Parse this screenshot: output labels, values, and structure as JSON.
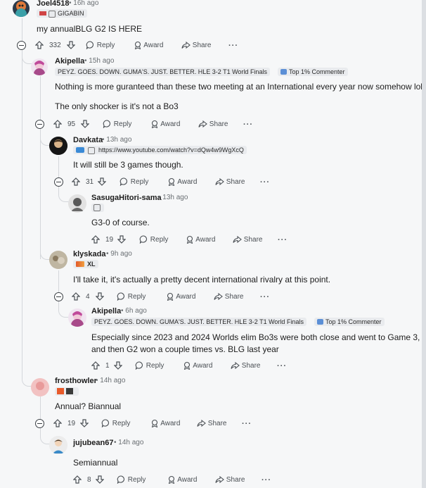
{
  "actions_labels": {
    "reply": "Reply",
    "award": "Award",
    "share": "Share",
    "more": "···"
  },
  "comments": [
    {
      "user": "Joel4518",
      "time": "16h ago",
      "flair": "GIGABIN",
      "text": "my annualBLG G2 IS HERE",
      "votes": "332"
    },
    {
      "user": "Akipella",
      "time": "15h ago",
      "flair": "PEYZ. GOES. DOWN. GUMA'S. JUST. BETTER. HLE 3-2 T1 World Finals",
      "badge": "Top 1% Commenter",
      "text": "Nothing is more guranteed than these two meeting at an International every year now somehow lol",
      "text2": "The only shocker is it's not a Bo3",
      "votes": "95"
    },
    {
      "user": "Davkata",
      "time": "13h ago",
      "flair": "https://www.youtube.com/watch?v=dQw4w9WgXcQ",
      "text": "It will still be 3 games though.",
      "votes": "31"
    },
    {
      "user": "SasugaHitori-sama",
      "time": "13h ago",
      "text": "G3-0 of course.",
      "votes": "19"
    },
    {
      "user": "klyskada",
      "time": "9h ago",
      "flair": "XL",
      "text": "I'll take it, it's actually a pretty decent international rivalry at this point.",
      "votes": "4"
    },
    {
      "user": "Akipella",
      "time": "6h ago",
      "flair": "PEYZ. GOES. DOWN. GUMA'S. JUST. BETTER. HLE 3-2 T1 World Finals",
      "badge": "Top 1% Commenter",
      "text": "Especially since 2023 and 2024 Worlds elim Bo3s were both close and went to Game 3, and then G2 won a couple times vs. BLG last year",
      "votes": "1"
    },
    {
      "user": "frosthowler",
      "time": "14h ago",
      "text": "Annual? Biannual",
      "votes": "19"
    },
    {
      "user": "jujubean67",
      "time": "14h ago",
      "text": "Semiannual",
      "votes": "8"
    }
  ],
  "colors": {
    "background": "#f6f7f8",
    "thread_line": "#d4d7db",
    "flair_bg": "#e9ebee",
    "badge_icon": "#5b8fd6"
  }
}
